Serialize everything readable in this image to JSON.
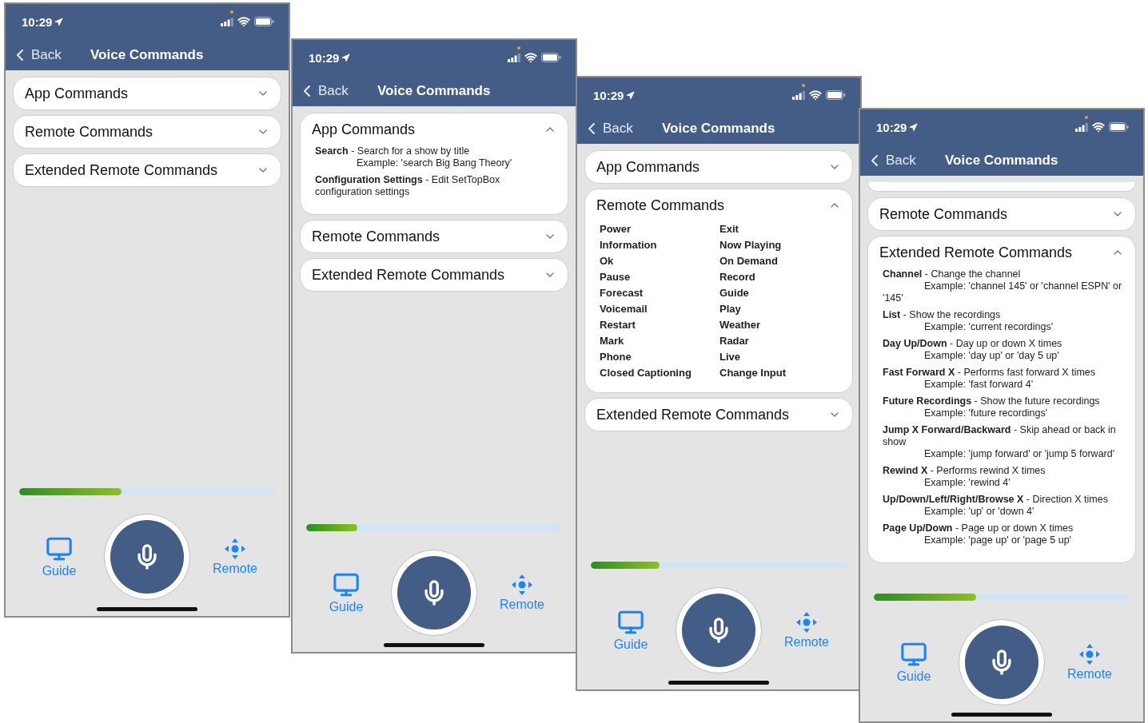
{
  "screens": [
    {
      "status": {
        "time": "10:29"
      },
      "nav": {
        "back": "Back",
        "title": "Voice Commands"
      },
      "sections": [
        {
          "title": "App Commands",
          "expanded": false
        },
        {
          "title": "Remote Commands",
          "expanded": false
        },
        {
          "title": "Extended Remote Commands",
          "expanded": false
        }
      ],
      "progress": {
        "level": 0.4
      },
      "tabs": [
        {
          "kind": "guide",
          "label": "Guide"
        },
        {
          "kind": "remote",
          "label": "Remote"
        }
      ]
    },
    {
      "status": {
        "time": "10:29"
      },
      "nav": {
        "back": "Back",
        "title": "Voice Commands"
      },
      "sections": [
        {
          "title": "App Commands",
          "expanded": true,
          "kind": "descriptions",
          "commands": [
            {
              "text": "**Search** - Search for a show by title",
              "example": "Example: 'search Big Bang Theory'"
            },
            {
              "text": "**Configuration Settings** - Edit SetTopBox configuration settings"
            }
          ]
        },
        {
          "title": "Remote Commands",
          "expanded": false
        },
        {
          "title": "Extended Remote Commands",
          "expanded": false
        }
      ],
      "progress": {
        "level": 0.2
      },
      "tabs": [
        {
          "kind": "guide",
          "label": "Guide"
        },
        {
          "kind": "remote",
          "label": "Remote"
        }
      ]
    },
    {
      "status": {
        "time": "10:29"
      },
      "nav": {
        "back": "Back",
        "title": "Voice Commands"
      },
      "sections": [
        {
          "title": "App Commands",
          "expanded": false
        },
        {
          "title": "Remote Commands",
          "expanded": true,
          "kind": "grid",
          "columns": [
            [
              "Power",
              "Information",
              "Ok",
              "Pause",
              "Forecast",
              "Voicemail",
              "Restart",
              "Mark",
              "Phone",
              "Closed Captioning"
            ],
            [
              "Exit",
              "Now Playing",
              "On Demand",
              "Record",
              "Guide",
              "Play",
              "Weather",
              "Radar",
              "Live",
              "Change Input"
            ]
          ]
        },
        {
          "title": "Extended Remote Commands",
          "expanded": false
        }
      ],
      "progress": {
        "level": 0.27
      },
      "tabs": [
        {
          "kind": "guide",
          "label": "Guide"
        },
        {
          "kind": "remote",
          "label": "Remote"
        }
      ]
    },
    {
      "status": {
        "time": "10:29"
      },
      "nav": {
        "back": "Back",
        "title": "Voice Commands"
      },
      "top_card_sliver": true,
      "sections": [
        {
          "title": "Remote Commands",
          "expanded": false
        },
        {
          "title": "Extended Remote Commands",
          "expanded": true,
          "kind": "descriptions",
          "commands": [
            {
              "text": "**Channel** - Change the channel",
              "example": "Example: 'channel 145' or 'channel ESPN' or '145'"
            },
            {
              "text": "**List** - Show the recordings",
              "example": "Example: 'current recordings'"
            },
            {
              "text": "**Day Up/Down** - Day up or down X times",
              "example": "Example: 'day up' or 'day 5 up'"
            },
            {
              "text": "**Fast Forward X** - Performs fast forward X times",
              "example": "Example: 'fast forward 4'"
            },
            {
              "text": "**Future Recordings** - Show the future recordings",
              "example": "Example: 'future recordings'"
            },
            {
              "text": "**Jump X Forward/Backward** - Skip ahead or back in show",
              "example": "Example: 'jump forward' or 'jump 5 forward'"
            },
            {
              "text": "**Rewind X** - Performs rewind X times",
              "example": "Example: 'rewind 4'"
            },
            {
              "text": "**Up/Down/Left/Right/Browse X** - Direction X times",
              "example": "Example: 'up' or 'down 4'"
            },
            {
              "text": "**Page Up/Down** - Page up or down X times",
              "example": "Example: 'page up' or 'page 5 up'"
            }
          ]
        }
      ],
      "progress": {
        "level": 0.4
      },
      "tabs": [
        {
          "kind": "guide",
          "label": "Guide"
        },
        {
          "kind": "remote",
          "label": "Remote"
        }
      ]
    }
  ]
}
